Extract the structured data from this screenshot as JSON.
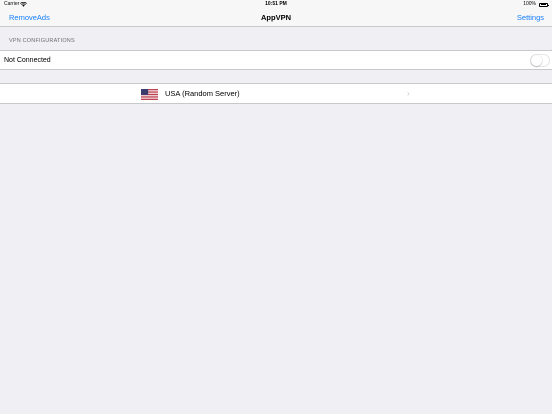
{
  "status_bar": {
    "carrier": "Carrier",
    "time": "10:51 PM",
    "battery": "100%",
    "icons": [
      "wifi-icon",
      "battery-icon"
    ]
  },
  "nav": {
    "left_label": "RemoveAds",
    "title": "AppVPN",
    "right_label": "Settings",
    "accent_color": "#147efb"
  },
  "vpn": {
    "section_header": "VPN CONFIGURATIONS",
    "status_label": "Not Connected",
    "toggle_on": false
  },
  "server": {
    "flag_icon": "usa-flag-icon",
    "label": "USA (Random Server)",
    "chevron_icon": "chevron-right-icon",
    "chevron_glyph": "›"
  }
}
